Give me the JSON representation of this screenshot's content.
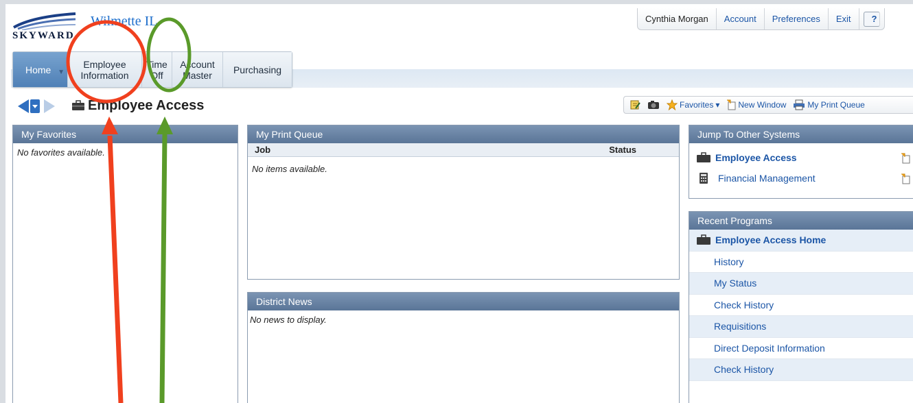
{
  "header": {
    "logo_text": "SKYWARD",
    "site_name": "Wilmette IL",
    "user_menu": {
      "user_name": "Cynthia Morgan",
      "account": "Account",
      "preferences": "Preferences",
      "exit": "Exit",
      "help": "?"
    }
  },
  "nav": {
    "tabs": [
      {
        "label": "Home"
      },
      {
        "label": "Employee\nInformation"
      },
      {
        "label": "Time\nOff"
      },
      {
        "label": "Account\nMaster"
      },
      {
        "label": "Purchasing"
      }
    ]
  },
  "page": {
    "title": "Employee Access"
  },
  "toolbar": {
    "favorites": "Favorites",
    "new_window": "New Window",
    "print_queue": "My Print Queue"
  },
  "favorites_panel": {
    "title": "My Favorites",
    "empty_text": "No favorites available."
  },
  "print_queue_panel": {
    "title": "My Print Queue",
    "col_job": "Job",
    "col_status": "Status",
    "empty_text": "No items available."
  },
  "news_panel": {
    "title": "District News",
    "empty_text": "No news to display."
  },
  "jump_panel": {
    "title": "Jump To Other Systems",
    "items": [
      {
        "label": "Employee Access"
      },
      {
        "label": "Financial Management"
      }
    ]
  },
  "recent_panel": {
    "title": "Recent Programs",
    "items": [
      {
        "label": "Employee Access Home"
      },
      {
        "label": "History"
      },
      {
        "label": "My Status"
      },
      {
        "label": "Check History"
      },
      {
        "label": "Requisitions"
      },
      {
        "label": "Direct Deposit Information"
      },
      {
        "label": "Check History"
      }
    ]
  },
  "colors": {
    "panel_header": "#6a84a5",
    "link": "#1b55a6",
    "home_tab": "#5b8bc0",
    "annotation_red": "#f0401e",
    "annotation_green": "#5a9a2a"
  }
}
